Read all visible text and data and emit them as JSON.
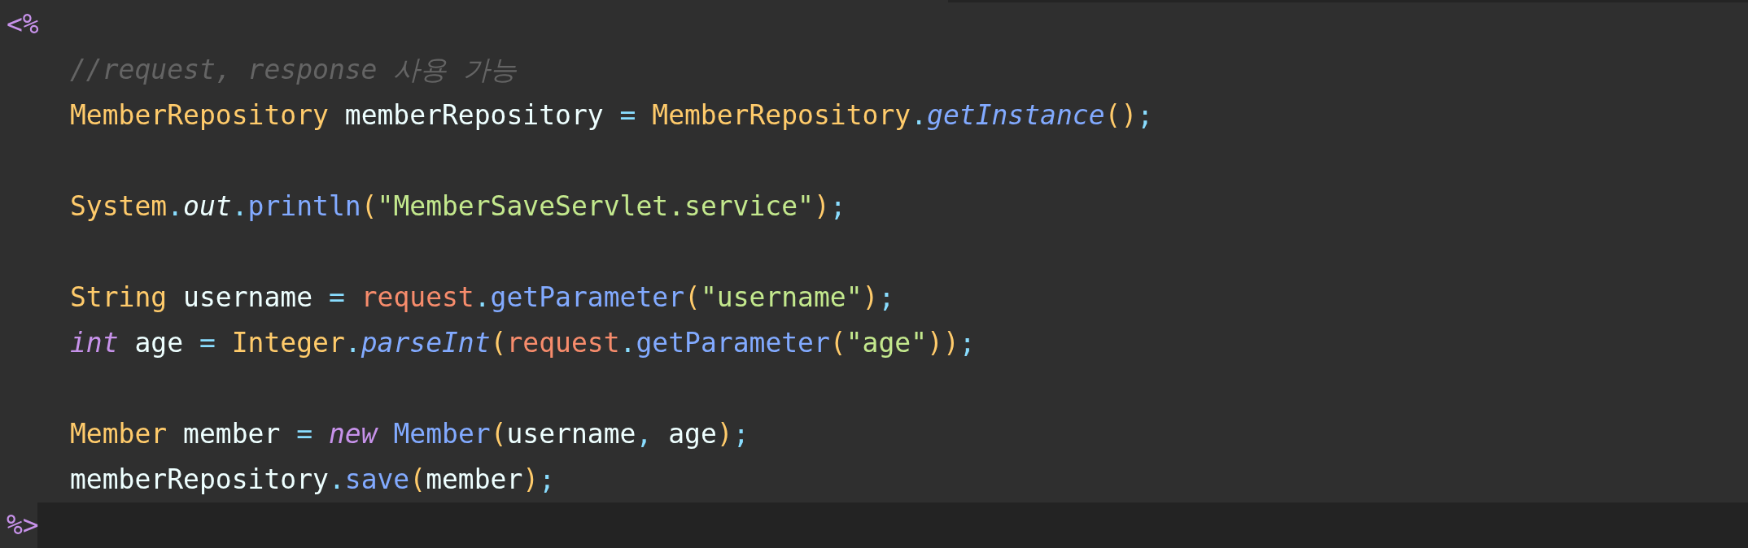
{
  "editor": {
    "lines": [
      {
        "kind": "tag",
        "current": false,
        "tokens": [
          {
            "kind": "tag",
            "text": "<%"
          }
        ]
      },
      {
        "kind": "code",
        "current": false,
        "tokens": [
          {
            "kind": "comment",
            "text": "//request, response 사용 가능"
          }
        ]
      },
      {
        "kind": "code",
        "current": false,
        "tokens": [
          {
            "kind": "type",
            "text": "MemberRepository"
          },
          {
            "kind": "ident",
            "text": " memberRepository "
          },
          {
            "kind": "op",
            "text": "= "
          },
          {
            "kind": "type",
            "text": "MemberRepository"
          },
          {
            "kind": "op",
            "text": "."
          },
          {
            "kind": "static-method",
            "text": "getInstance"
          },
          {
            "kind": "paren",
            "text": "()"
          },
          {
            "kind": "op",
            "text": ";"
          }
        ]
      },
      {
        "kind": "blank",
        "current": false
      },
      {
        "kind": "code",
        "current": false,
        "tokens": [
          {
            "kind": "type",
            "text": "System"
          },
          {
            "kind": "op",
            "text": "."
          },
          {
            "kind": "static-field",
            "text": "out"
          },
          {
            "kind": "op",
            "text": "."
          },
          {
            "kind": "method",
            "text": "println"
          },
          {
            "kind": "paren",
            "text": "("
          },
          {
            "kind": "string",
            "text": "\"MemberSaveServlet.service\""
          },
          {
            "kind": "paren",
            "text": ")"
          },
          {
            "kind": "op",
            "text": ";"
          }
        ]
      },
      {
        "kind": "blank",
        "current": false
      },
      {
        "kind": "code",
        "current": false,
        "tokens": [
          {
            "kind": "type",
            "text": "String"
          },
          {
            "kind": "ident",
            "text": " username "
          },
          {
            "kind": "op",
            "text": "= "
          },
          {
            "kind": "param",
            "text": "request"
          },
          {
            "kind": "op",
            "text": "."
          },
          {
            "kind": "method",
            "text": "getParameter"
          },
          {
            "kind": "paren",
            "text": "("
          },
          {
            "kind": "string",
            "text": "\"username\""
          },
          {
            "kind": "paren",
            "text": ")"
          },
          {
            "kind": "op",
            "text": ";"
          }
        ]
      },
      {
        "kind": "code",
        "current": false,
        "tokens": [
          {
            "kind": "keyword",
            "text": "int"
          },
          {
            "kind": "ident",
            "text": " age "
          },
          {
            "kind": "op",
            "text": "= "
          },
          {
            "kind": "type",
            "text": "Integer"
          },
          {
            "kind": "op",
            "text": "."
          },
          {
            "kind": "static-method",
            "text": "parseInt"
          },
          {
            "kind": "paren",
            "text": "("
          },
          {
            "kind": "param",
            "text": "request"
          },
          {
            "kind": "op",
            "text": "."
          },
          {
            "kind": "method",
            "text": "getParameter"
          },
          {
            "kind": "paren",
            "text": "("
          },
          {
            "kind": "string",
            "text": "\"age\""
          },
          {
            "kind": "paren",
            "text": "))"
          },
          {
            "kind": "op",
            "text": ";"
          }
        ]
      },
      {
        "kind": "blank",
        "current": false
      },
      {
        "kind": "code",
        "current": false,
        "tokens": [
          {
            "kind": "type",
            "text": "Member"
          },
          {
            "kind": "ident",
            "text": " member "
          },
          {
            "kind": "op",
            "text": "= "
          },
          {
            "kind": "keyword",
            "text": "new "
          },
          {
            "kind": "method",
            "text": "Member"
          },
          {
            "kind": "paren",
            "text": "("
          },
          {
            "kind": "ident",
            "text": "username"
          },
          {
            "kind": "op",
            "text": ", "
          },
          {
            "kind": "ident",
            "text": "age"
          },
          {
            "kind": "paren",
            "text": ")"
          },
          {
            "kind": "op",
            "text": ";"
          }
        ]
      },
      {
        "kind": "code",
        "current": false,
        "tokens": [
          {
            "kind": "ident",
            "text": "memberRepository"
          },
          {
            "kind": "op",
            "text": "."
          },
          {
            "kind": "method",
            "text": "save"
          },
          {
            "kind": "paren",
            "text": "("
          },
          {
            "kind": "ident",
            "text": "member"
          },
          {
            "kind": "paren",
            "text": ")"
          },
          {
            "kind": "op",
            "text": ";"
          }
        ]
      },
      {
        "kind": "tag",
        "current": true,
        "tokens": [
          {
            "kind": "tag",
            "text": "%>"
          }
        ]
      }
    ]
  }
}
